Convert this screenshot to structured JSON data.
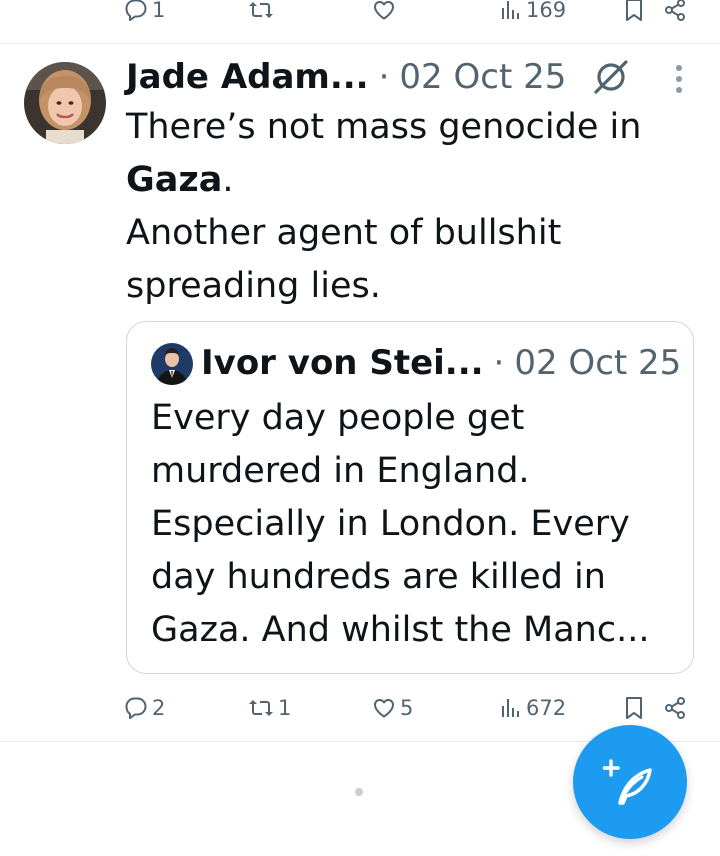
{
  "top_actions": {
    "replies": "1",
    "reposts": "",
    "likes": "",
    "views": "169"
  },
  "tweet": {
    "author": "Jade Adam...",
    "separator": "·",
    "date": "02 Oct 25",
    "text_line1": "There’s not mass genocide in",
    "text_bold": "Gaza",
    "text_after_bold": ".",
    "text_line3": "Another agent of bullshit spreading lies.",
    "quote": {
      "author": "Ivor von Stei...",
      "separator": "·",
      "date": "02 Oct 25",
      "text": "Every day people get murdered in England. Especially in London. Every day hundreds are killed in Gaza. And whilst the Manc..."
    },
    "actions": {
      "replies": "2",
      "reposts": "1",
      "likes": "5",
      "views": "672"
    }
  },
  "colors": {
    "accent": "#1d9bf0",
    "secondary_text": "#536471",
    "border": "#cfd9de"
  },
  "icons": {
    "reply": "reply-icon",
    "repost": "repost-icon",
    "like": "like-icon",
    "views": "views-icon",
    "bookmark": "bookmark-icon",
    "share": "share-icon",
    "grok": "grok-icon",
    "more": "more-icon",
    "compose": "compose-post-icon"
  }
}
